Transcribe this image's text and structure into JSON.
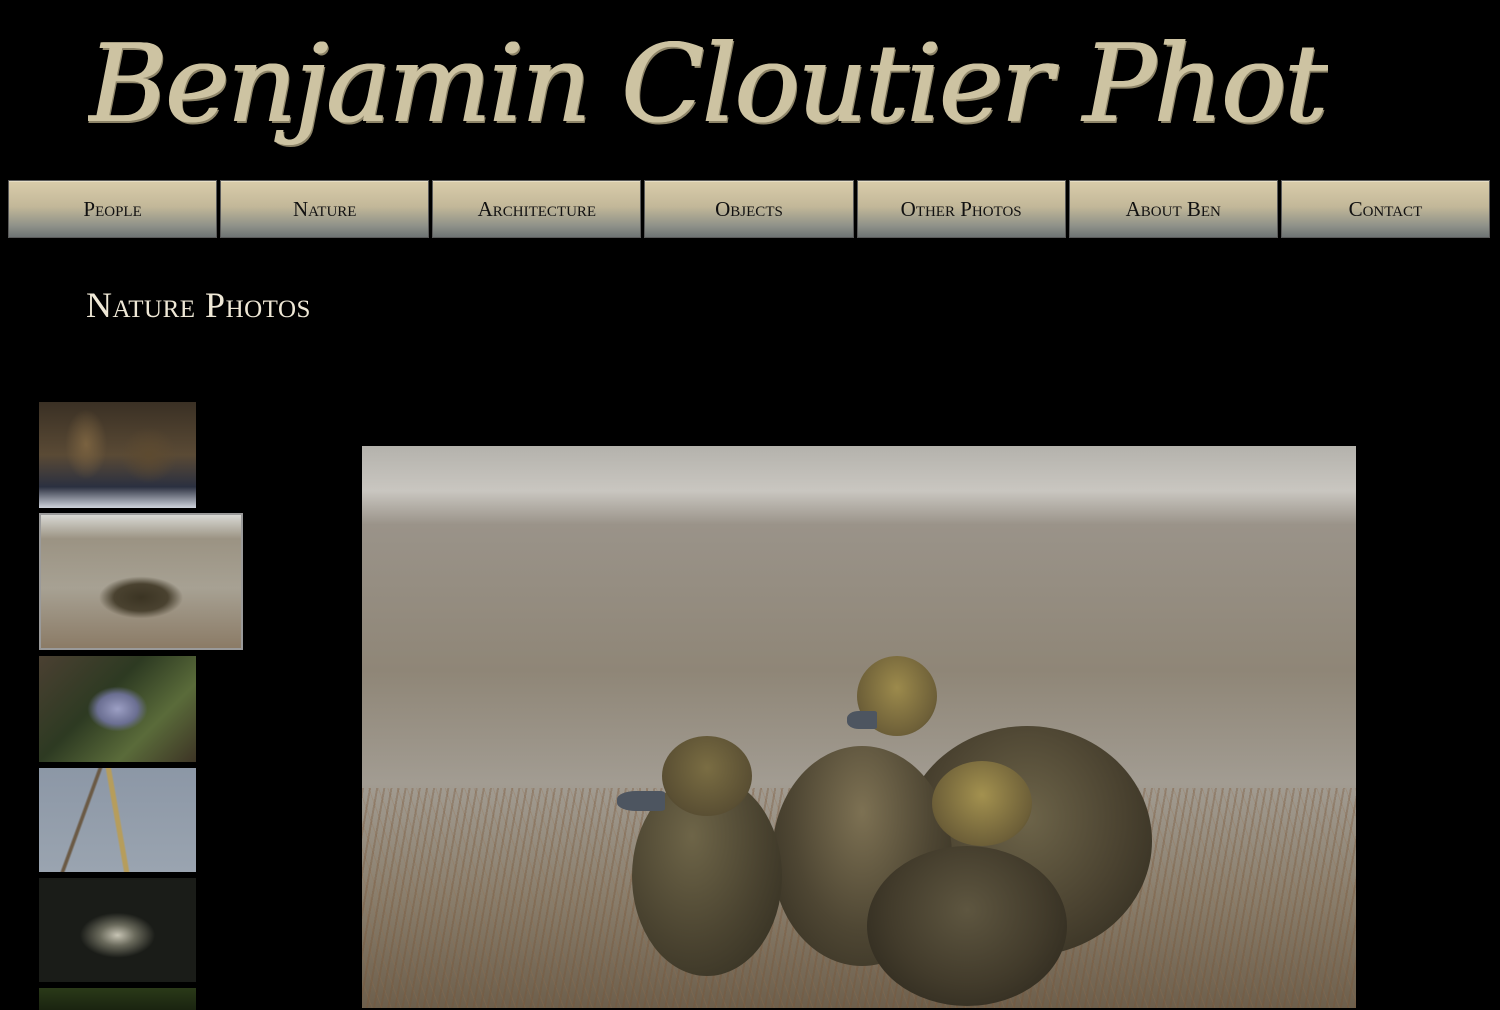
{
  "site": {
    "logo_text": "Benjamin Cloutier Photography"
  },
  "nav": {
    "items": [
      {
        "label": "People"
      },
      {
        "label": "Nature"
      },
      {
        "label": "Architecture"
      },
      {
        "label": "Objects"
      },
      {
        "label": "Other Photos"
      },
      {
        "label": "About Ben"
      },
      {
        "label": "Contact"
      }
    ]
  },
  "page": {
    "title": "Nature Photos"
  },
  "gallery": {
    "thumbnails": [
      {
        "subject": "deer-in-snow"
      },
      {
        "subject": "ducklings",
        "selected": true
      },
      {
        "subject": "frosted-leaf"
      },
      {
        "subject": "bare-twigs"
      },
      {
        "subject": "moon-in-clouds"
      },
      {
        "subject": "green-scene"
      }
    ],
    "main_image_subject": "ducklings"
  },
  "colors": {
    "background": "#000000",
    "logo": "#cdc3a2",
    "title": "#efe8d6",
    "nav_gradient_top": "#d9ccaa",
    "nav_gradient_bottom": "#6e7474"
  }
}
